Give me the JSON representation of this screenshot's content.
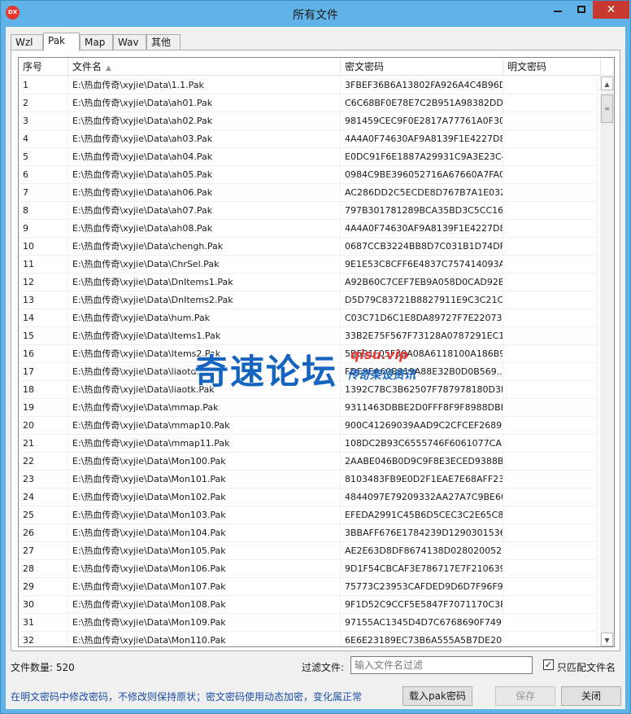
{
  "window": {
    "title": "所有文件",
    "icon_text": "DX",
    "minimize_glyph": "",
    "close_glyph": "✕"
  },
  "tabs": [
    "Wzl",
    "Pak",
    "Map",
    "Wav",
    "其他"
  ],
  "active_tab": "Pak",
  "columns": [
    "序号",
    "文件名",
    "密文密码",
    "明文密码"
  ],
  "rows": [
    {
      "num": "1",
      "file": "E:\\热血传奇\\xyjie\\Data\\1.1.Pak",
      "cipher": "3FBEF36B6A13802FA926A4C4B96D..."
    },
    {
      "num": "2",
      "file": "E:\\热血传奇\\xyjie\\Data\\ah01.Pak",
      "cipher": "C6C68BF0E78E7C2B951A98382DDE..."
    },
    {
      "num": "3",
      "file": "E:\\热血传奇\\xyjie\\Data\\ah02.Pak",
      "cipher": "981459CEC9F0E2817A77761A0F30..."
    },
    {
      "num": "4",
      "file": "E:\\热血传奇\\xyjie\\Data\\ah03.Pak",
      "cipher": "4A4A0F74630AF9A8139F1E4227D8..."
    },
    {
      "num": "5",
      "file": "E:\\热血传奇\\xyjie\\Data\\ah04.Pak",
      "cipher": "E0DC91F6E1887A29931C9A3E23C4..."
    },
    {
      "num": "6",
      "file": "E:\\热血传奇\\xyjie\\Data\\ah05.Pak",
      "cipher": "0984C9BE396052716A67660A7FA0..."
    },
    {
      "num": "7",
      "file": "E:\\热血传奇\\xyjie\\Data\\ah06.Pak",
      "cipher": "AC286DD2C5ECDE8D767B7A1E032..."
    },
    {
      "num": "8",
      "file": "E:\\热血传奇\\xyjie\\Data\\ah07.Pak",
      "cipher": "797B301781289BCA35BD3C5CC165..."
    },
    {
      "num": "9",
      "file": "E:\\热血传奇\\xyjie\\Data\\ah08.Pak",
      "cipher": "4A4A0F74630AF9A8139F1E4227D8..."
    },
    {
      "num": "10",
      "file": "E:\\热血传奇\\xyjie\\Data\\chengh.Pak",
      "cipher": "0687CCB3224BB8D7C031B1D74DFE..."
    },
    {
      "num": "11",
      "file": "E:\\热血传奇\\xyjie\\Data\\ChrSel.Pak",
      "cipher": "9E1E53C8CFF6E4837C757414093A..."
    },
    {
      "num": "12",
      "file": "E:\\热血传奇\\xyjie\\Data\\DnItems1.Pak",
      "cipher": "A92B60C7CEF7EB9A058D0CAD92B..."
    },
    {
      "num": "13",
      "file": "E:\\热血传奇\\xyjie\\Data\\DnItems2.Pak",
      "cipher": "D5D79C83721B8827911E9C3C21C2..."
    },
    {
      "num": "14",
      "file": "E:\\热血传奇\\xyjie\\Data\\hum.Pak",
      "cipher": "C03C71D6C1E8DA89727F7E220738..."
    },
    {
      "num": "15",
      "file": "E:\\热血传奇\\xyjie\\Data\\Items1.Pak",
      "cipher": "33B2E75F567F73128A0787291EC1..."
    },
    {
      "num": "16",
      "file": "E:\\热血传奇\\xyjie\\Data\\Items2.Pak",
      "cipher": "5B591F05F39A08A6118100A186B9..."
    },
    {
      "num": "17",
      "file": "E:\\热血传奇\\xyjie\\Data\\liaotd.Pak",
      "cipher": "FDE9EA60B919A88E32B0D0B569..."
    },
    {
      "num": "18",
      "file": "E:\\热血传奇\\xyjie\\Data\\liaotk.Pak",
      "cipher": "1392C7BC3B62507F787978180D3E..."
    },
    {
      "num": "19",
      "file": "E:\\热血传奇\\xyjie\\Data\\mmap.Pak",
      "cipher": "9311463DBBE2D0FFF8F9F8988DBE..."
    },
    {
      "num": "20",
      "file": "E:\\热血传奇\\xyjie\\Data\\mmap10.Pak",
      "cipher": "900C41269039AAD9C2CFCEF2689B..."
    },
    {
      "num": "21",
      "file": "E:\\热血传奇\\xyjie\\Data\\mmap11.Pak",
      "cipher": "108DC2B93C6555746F6061077CAF..."
    },
    {
      "num": "22",
      "file": "E:\\热血传奇\\xyjie\\Data\\Mon100.Pak",
      "cipher": "2AABE046B0D9C9F8E3ECED9388BB..."
    },
    {
      "num": "23",
      "file": "E:\\热血传奇\\xyjie\\Data\\Mon101.Pak",
      "cipher": "8103483FB9E0D2F1EAE7E68AFF23..."
    },
    {
      "num": "24",
      "file": "E:\\热血传奇\\xyjie\\Data\\Mon102.Pak",
      "cipher": "4844097E79209332AA27A7C9BE60..."
    },
    {
      "num": "25",
      "file": "E:\\热血传奇\\xyjie\\Data\\Mon103.Pak",
      "cipher": "EFEDA2991C45B6D5CEC3C2E65C8..."
    },
    {
      "num": "26",
      "file": "E:\\热血传奇\\xyjie\\Data\\Mon104.Pak",
      "cipher": "3BBAFF676E1784239D1290301536..."
    },
    {
      "num": "27",
      "file": "E:\\热血传奇\\xyjie\\Data\\Mon105.Pak",
      "cipher": "AE2E63D8DF8674138D0280200526..."
    },
    {
      "num": "28",
      "file": "E:\\热血传奇\\xyjie\\Data\\Mon106.Pak",
      "cipher": "9D1F54CBCAF3E786717E7F210639..."
    },
    {
      "num": "29",
      "file": "E:\\热血传奇\\xyjie\\Data\\Mon107.Pak",
      "cipher": "75773C23953CAFDED9D6D7F96F90..."
    },
    {
      "num": "30",
      "file": "E:\\热血传奇\\xyjie\\Data\\Mon108.Pak",
      "cipher": "9F1D52C9CCF5E5847F7071170C3F..."
    },
    {
      "num": "31",
      "file": "E:\\热血传奇\\xyjie\\Data\\Mon109.Pak",
      "cipher": "97155AC1345D4D7C6768690F7497..."
    },
    {
      "num": "32",
      "file": "E:\\热血传奇\\xyjie\\Data\\Mon110.Pak",
      "cipher": "6E6E23189EC73B6A555A5B7DE204..."
    }
  ],
  "footer": {
    "count_label": "文件数量: 520",
    "filter_label": "过滤文件:",
    "filter_placeholder": "输入文件名过滤",
    "filter_value": "",
    "checkbox_label": "只匹配文件名",
    "checkbox_checked": true,
    "hint": "在明文密码中修改密码，不修改则保持原状；密文密码使用动态加密，变化属正常",
    "load_button": "载入pak密码",
    "save_button": "保存",
    "close_button": "关闭"
  },
  "watermark": {
    "main": "奇速论坛",
    "url": "qisu.vip",
    "sub": "传奇架设资讯"
  },
  "colors": {
    "titlebar": "#5fb3e6",
    "close_button": "#c7382e",
    "hint_text": "#1b4fa6",
    "watermark_blue": "#1565c0",
    "watermark_red": "#e53935"
  }
}
